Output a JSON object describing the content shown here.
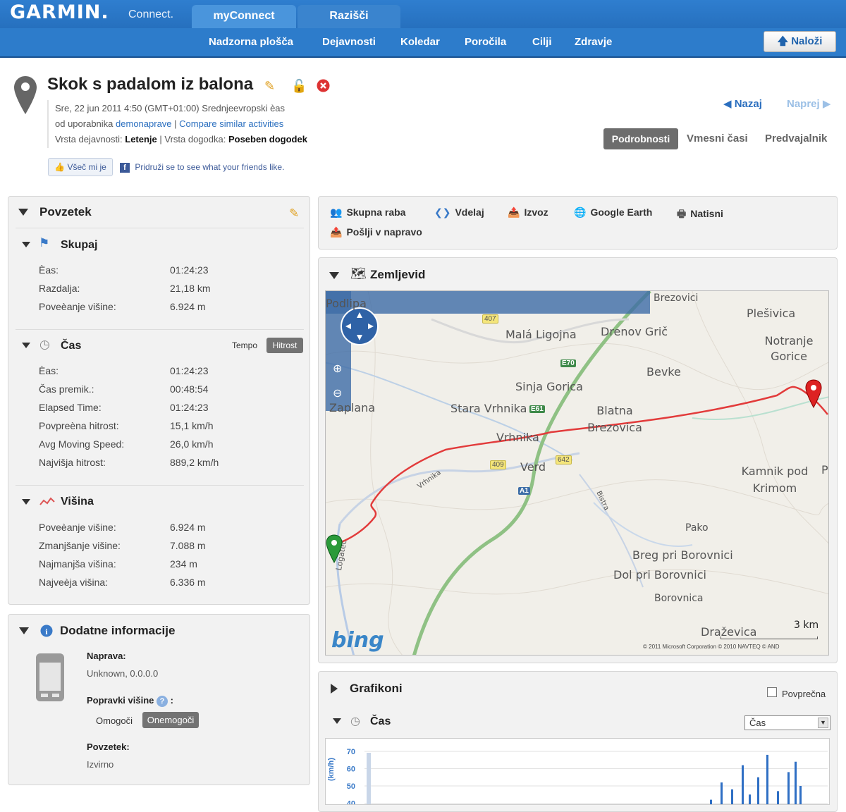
{
  "brand": {
    "logo": "GARMIN.",
    "sub": "Connect."
  },
  "top_tabs": [
    "myConnect",
    "Razišči"
  ],
  "nav": [
    "Nadzorna plošča",
    "Dejavnosti",
    "Koledar",
    "Poročila",
    "Cilji",
    "Zdravje"
  ],
  "upload_label": "Naloži",
  "activity": {
    "title": "Skok s padalom iz balona",
    "date_line": "Sre, 22 jun 2011 4:50 (GMT+01:00) Srednjeevropski èas",
    "user_prefix": "od uporabnika",
    "user": "demonaprave",
    "compare": "Compare similar activities",
    "type_label": "Vrsta dejavnosti:",
    "type_value": "Letenje",
    "event_label": "Vrsta dogodka:",
    "event_value": "Poseben dogodek"
  },
  "like_label": "Všeč mi je",
  "fb_text": "Pridruži se to see what your friends like.",
  "pager": {
    "back": "Nazaj",
    "next": "Naprej"
  },
  "view_tabs": [
    "Podrobnosti",
    "Vmesni časi",
    "Predvajalnik"
  ],
  "summary": {
    "title": "Povzetek",
    "total": {
      "title": "Skupaj",
      "rows": [
        {
          "label": "Èas:",
          "value": "01:24:23"
        },
        {
          "label": "Razdalja:",
          "value": "21,18 km"
        },
        {
          "label": "Poveèanje višine:",
          "value": "6.924 m"
        }
      ]
    },
    "time": {
      "title": "Čas",
      "toggle": [
        "Tempo",
        "Hitrost"
      ],
      "rows": [
        {
          "label": "Èas:",
          "value": "01:24:23"
        },
        {
          "label": "Čas premik.:",
          "value": "00:48:54"
        },
        {
          "label": "Elapsed Time:",
          "value": "01:24:23"
        },
        {
          "label": "Povpreèna hitrost:",
          "value": "15,1 km/h"
        },
        {
          "label": "Avg Moving Speed:",
          "value": "26,0 km/h"
        },
        {
          "label": "Najvišja hitrost:",
          "value": "889,2 km/h"
        }
      ]
    },
    "elevation": {
      "title": "Višina",
      "rows": [
        {
          "label": "Poveèanje višine:",
          "value": "6.924 m"
        },
        {
          "label": "Zmanjšanje višine:",
          "value": "7.088 m"
        },
        {
          "label": "Najmanjša višina:",
          "value": "234 m"
        },
        {
          "label": "Najveèja višina:",
          "value": "6.336 m"
        }
      ]
    }
  },
  "extra": {
    "title": "Dodatne informacije",
    "device_label": "Naprava:",
    "device_value": "Unknown, 0.0.0.0",
    "elev_fix_label": "Popravki višine",
    "elev_fix_options": [
      "Omogoči",
      "Onemogoči"
    ],
    "summary_label": "Povzetek:",
    "summary_value": "Izvirno"
  },
  "actions": [
    "Skupna raba",
    "Vdelaj",
    "Izvoz",
    "Google Earth",
    "Natisni",
    "Pošlji v napravo"
  ],
  "map": {
    "title": "Zemljevid",
    "labels": [
      "Podlipa",
      "Malá Ligojna",
      "Drenov Grič",
      "Brezovici",
      "Plešivica",
      "Notranje Gorice",
      "Bevke",
      "Sinja Gorica",
      "Zaplana",
      "Stara Vrhnika",
      "Blatna Brezovica",
      "Vrhnika",
      "Verd",
      "Kamnik pod Krimom",
      "Pako",
      "Breg pri Borovnici",
      "Dol pri Borovnici",
      "Borovnica",
      "Draževica",
      "Logatec",
      "Vrhnika",
      "Bistra",
      "P"
    ],
    "shields": [
      "407",
      "E70",
      "E61",
      "409",
      "642",
      "A1"
    ],
    "scale": "3 km",
    "brand": "bing",
    "copyright": "© 2011 Microsoft Corporation   © 2010 NAVTEQ   © AND"
  },
  "charts": {
    "title": "Grafikoni",
    "average_label": "Povprečna",
    "time_label": "Čas",
    "select_value": "Čas",
    "y_label": "(km/h)"
  },
  "chart_data": {
    "type": "bar",
    "ylabel": "(km/h)",
    "yticks": [
      70,
      60,
      50,
      40
    ],
    "ylim": [
      40,
      70
    ],
    "note": "partially visible speed chart",
    "values": [
      42,
      52,
      48,
      62,
      45,
      55,
      68,
      47,
      58,
      64,
      50
    ]
  }
}
